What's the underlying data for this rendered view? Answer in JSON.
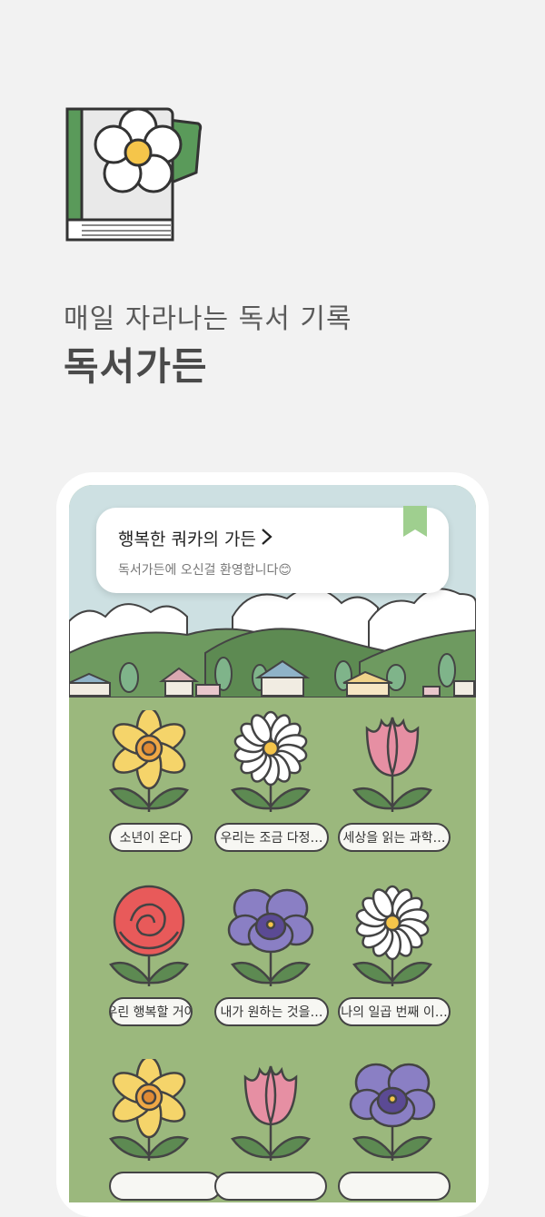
{
  "header": {
    "subtitle": "매일 자라나는 독서 기록",
    "title": "독서가든"
  },
  "card": {
    "title": "행복한 쿼카의 가든",
    "subtitle": "독서가든에 오신걸 환영합니다😊"
  },
  "books": [
    {
      "label": "소년이 온다",
      "flower": "daffodil"
    },
    {
      "label": "우리는 조금 다정…",
      "flower": "daisy"
    },
    {
      "label": "세상을 읽는 과학…",
      "flower": "tulip"
    },
    {
      "label": "우린 행복할 거야",
      "flower": "rose"
    },
    {
      "label": "내가 원하는 것을…",
      "flower": "pansy"
    },
    {
      "label": "나의 일곱 번째 이…",
      "flower": "daisy"
    },
    {
      "label": "",
      "flower": "daffodil"
    },
    {
      "label": "",
      "flower": "tulip"
    },
    {
      "label": "",
      "flower": "pansy"
    }
  ],
  "colors": {
    "background": "#f2f2f2",
    "sky": "#cde0e2",
    "grass": "#9bb87d",
    "bookmark": "#9fcf8f"
  }
}
